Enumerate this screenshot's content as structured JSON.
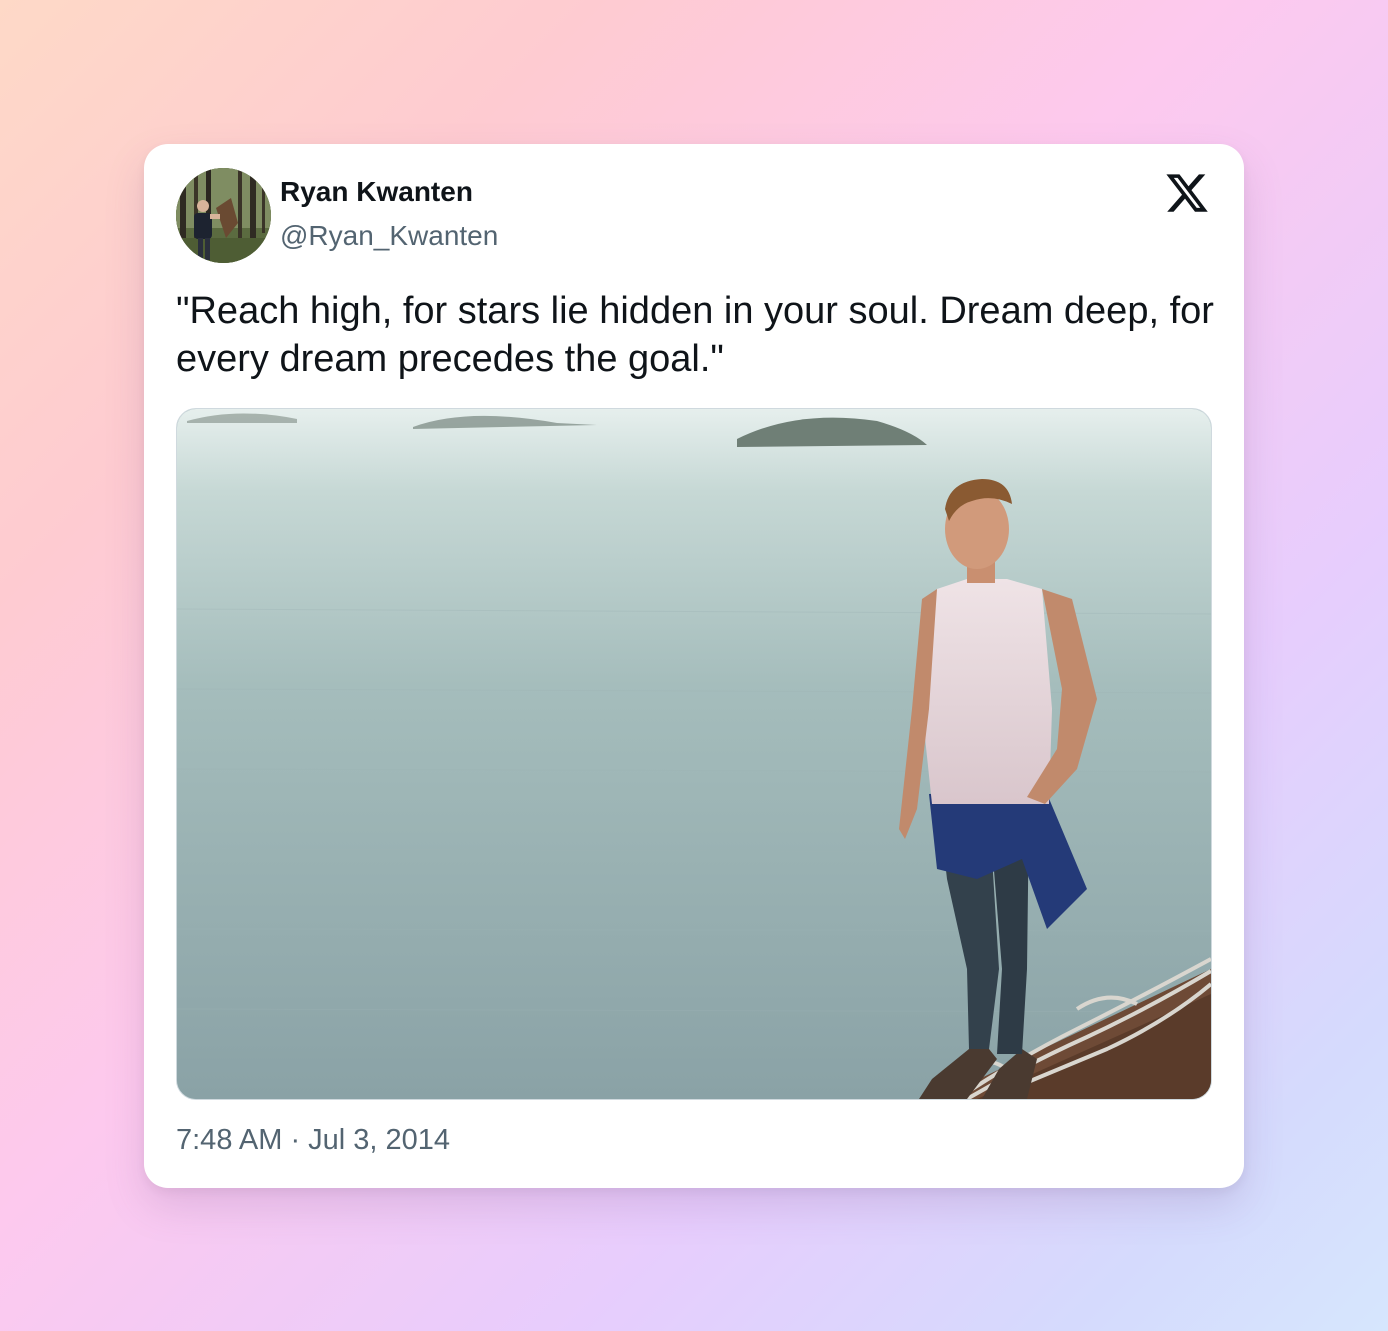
{
  "tweet": {
    "author": {
      "display_name": "Ryan Kwanten",
      "handle": "@Ryan_Kwanten",
      "avatar_icon": "avatar-forest-hiker"
    },
    "brand_icon": "x-logo-icon",
    "text": "\"Reach high, for stars lie hidden in your soul. Dream deep, for every dream precedes the goal.\"",
    "media_icon": "photo-man-on-cliff-above-sea",
    "timestamp": "7:48 AM · Jul 3, 2014"
  },
  "colors": {
    "text_primary": "#0f1419",
    "text_secondary": "#536471",
    "card_background": "#ffffff"
  }
}
